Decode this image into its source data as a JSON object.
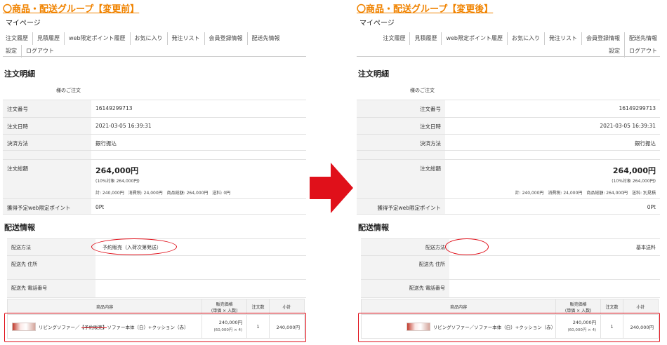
{
  "accent_color": "#f08300",
  "mark_color": "#e0101a",
  "arrow_icon": "right-arrow-icon",
  "common": {
    "mypage": "マイページ",
    "nav": [
      "注文履歴",
      "見積履歴",
      "web限定ポイント履歴",
      "お気に入り",
      "発注リスト",
      "会員登録情報",
      "配送先情報",
      "設定",
      "ログアウト"
    ],
    "order_heading": "注文明細",
    "customer_suffix": "様のご注文",
    "order_number_label": "注文番号",
    "order_number": "16149299713",
    "order_date_label": "注文日時",
    "order_date": "2021-03-05 16:39:31",
    "payment_label": "決済方法",
    "payment": "銀行振込",
    "total_label": "注文総額",
    "total": "264,000円",
    "tax_note": "(10%対象 264,000円)",
    "points_label": "獲得予定web限定ポイント",
    "points": "0Pt",
    "shipping_heading": "配送情報",
    "ship_method_label": "配送方法",
    "ship_address_label": "配送先 住所",
    "ship_phone_label": "配送先 電話番号",
    "col_item": "商品内容",
    "col_price_1": "販売価格",
    "col_price_2": "(単価 × 入数)",
    "col_qty": "注文数",
    "col_subtotal": "小計",
    "unit_price": "240,000円",
    "unit_detail": "(60,000円 × 4)",
    "qty": "1",
    "subtotal": "240,000円"
  },
  "before": {
    "heading": "〇商品・配送グループ【変更前】",
    "breakdown": "計: 240,000円　消費税: 24,000円　商品総額: 264,000円　送料: 0円",
    "ship_method": "予約販売（入荷次第発送）",
    "product_prefix": "リビングソファー／",
    "product_tag": "【予約販売】",
    "product_rest": "ソファー本体（白）+クッション（赤）"
  },
  "after": {
    "heading": "〇商品・配送グループ【変更後】",
    "breakdown": "計: 240,000円　消費税: 24,000円　商品総額: 264,000円　送料: 別見積",
    "ship_method": "基本送料",
    "product_name": "リビングソファー／ソファー本体（白）+クッション（赤）"
  }
}
